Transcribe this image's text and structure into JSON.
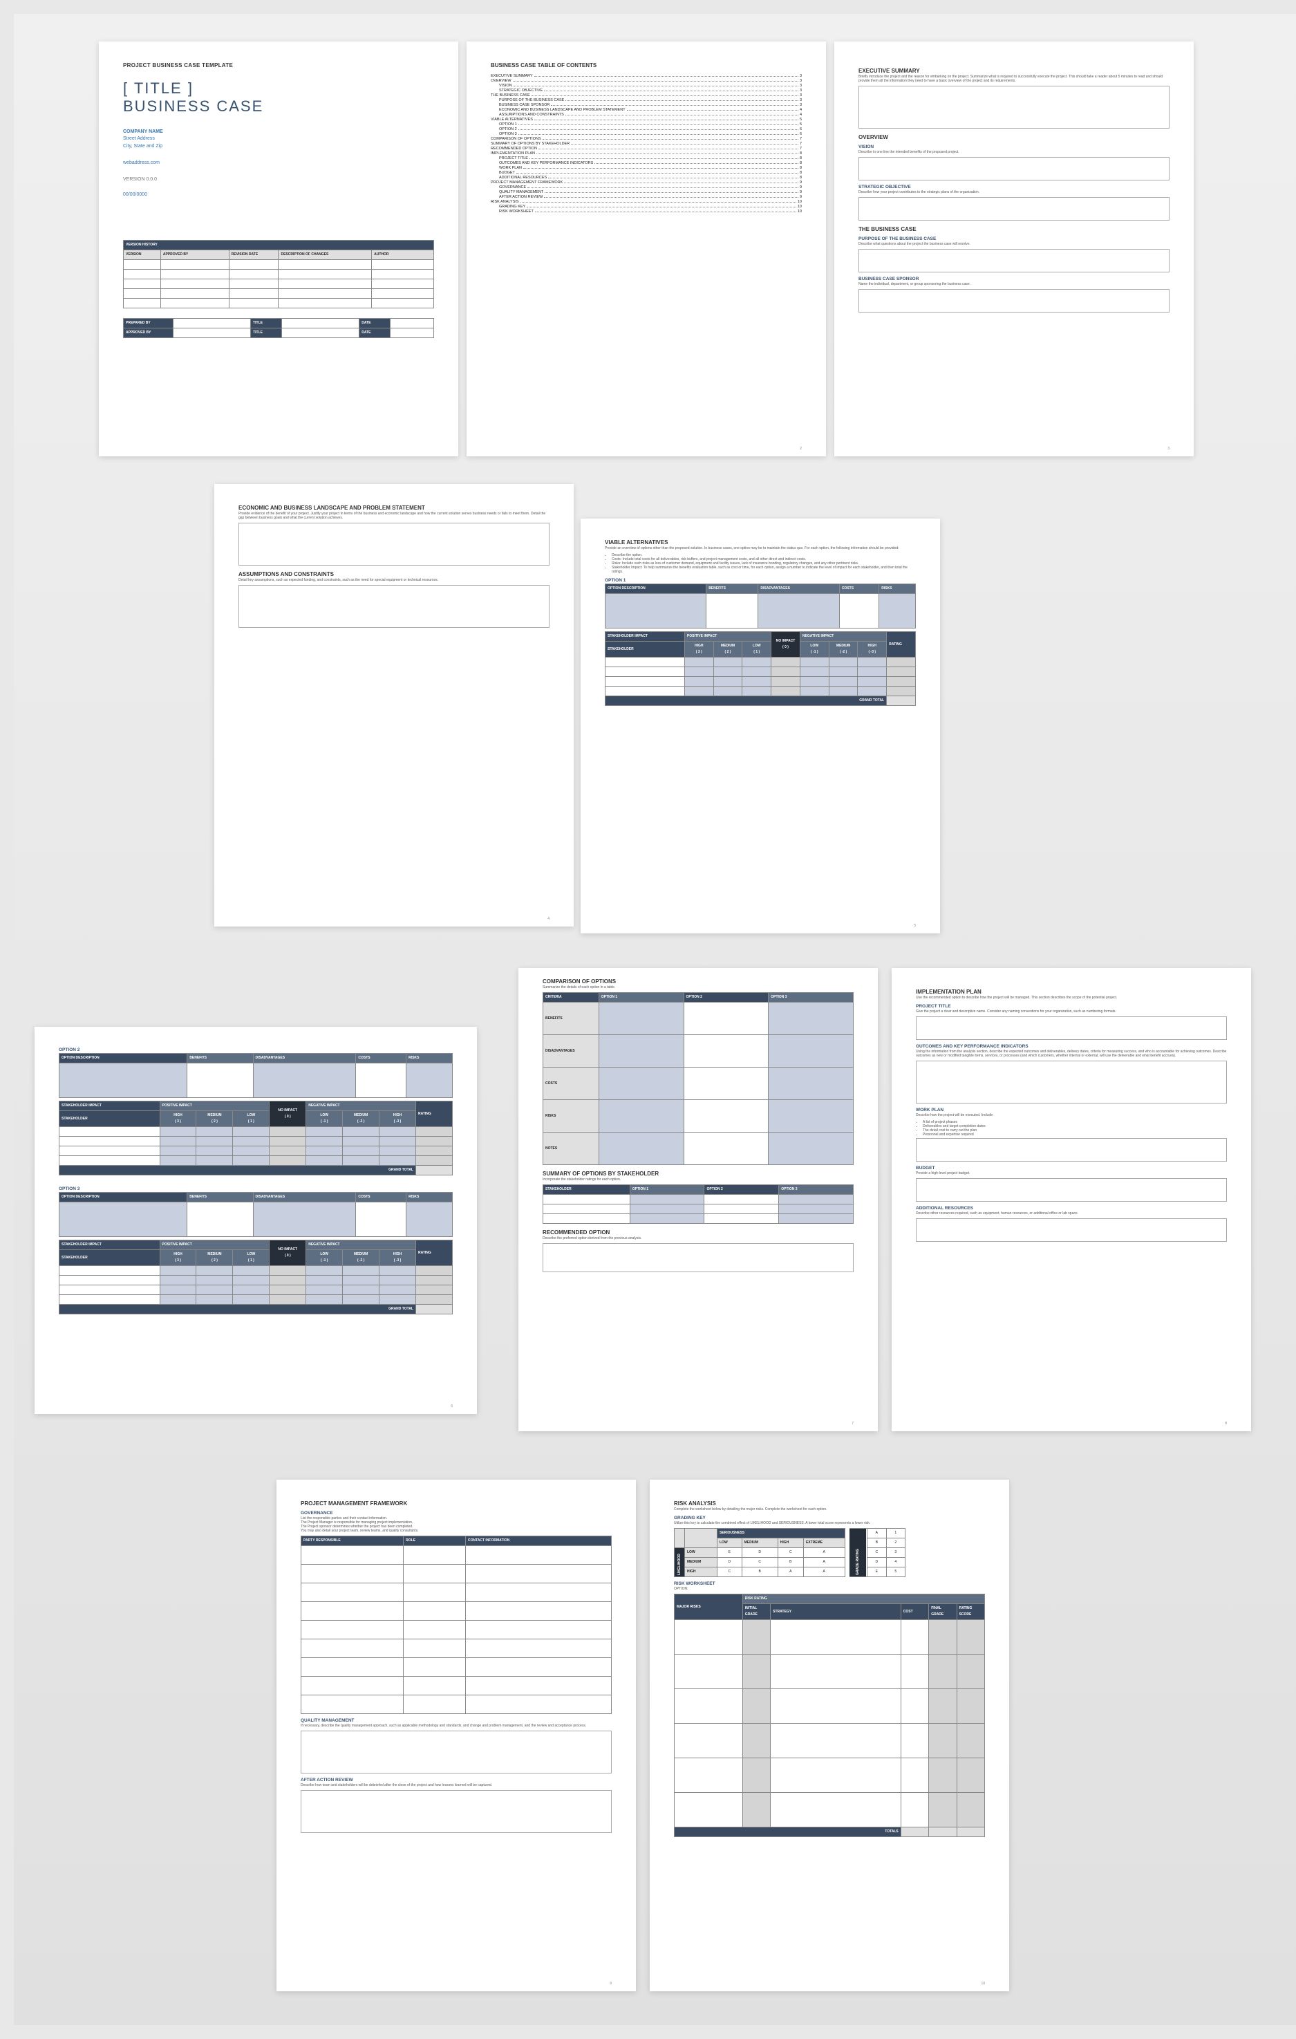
{
  "p1": {
    "label": "PROJECT BUSINESS CASE TEMPLATE",
    "title": "[ TITLE ]\nBUSINESS CASE",
    "company": "COMPANY NAME",
    "addr1": "Street Address",
    "addr2": "City, State and Zip",
    "web": "webaddress.com",
    "ver": "VERSION 0.0.0",
    "date": "00/00/0000",
    "vh": "VERSION HISTORY",
    "cols": [
      "VERSION",
      "APPROVED BY",
      "REVISION DATE",
      "DESCRIPTION OF CHANGES",
      "AUTHOR"
    ],
    "sig": {
      "pb": "PREPARED BY",
      "ab": "APPROVED BY",
      "t": "TITLE",
      "d": "DATE"
    }
  },
  "p2": {
    "h": "BUSINESS CASE TABLE OF CONTENTS",
    "items": [
      [
        "EXECUTIVE SUMMARY",
        "3",
        0
      ],
      [
        "OVERVIEW",
        "3",
        0
      ],
      [
        "VISION",
        "3",
        1
      ],
      [
        "STRATEGIC OBJECTIVE",
        "3",
        1
      ],
      [
        "THE BUSINESS CASE",
        "3",
        0
      ],
      [
        "PURPOSE OF THE BUSINESS CASE",
        "3",
        1
      ],
      [
        "BUSINESS CASE SPONSOR",
        "3",
        1
      ],
      [
        "ECONOMIC AND BUSINESS LANDSCAPE AND PROBLEM STATEMENT",
        "4",
        1
      ],
      [
        "ASSUMPTIONS AND CONSTRAINTS",
        "4",
        1
      ],
      [
        "VIABLE ALTERNATIVES",
        "5",
        0
      ],
      [
        "OPTION 1",
        "5",
        1
      ],
      [
        "OPTION 2",
        "6",
        1
      ],
      [
        "OPTION 3",
        "6",
        1
      ],
      [
        "COMPARISON OF OPTIONS",
        "7",
        0
      ],
      [
        "SUMMARY OF OPTIONS BY STAKEHOLDER",
        "7",
        0
      ],
      [
        "RECOMMENDED OPTION",
        "7",
        0
      ],
      [
        "IMPLEMENTATION PLAN",
        "8",
        0
      ],
      [
        "PROJECT TITLE",
        "8",
        1
      ],
      [
        "OUTCOMES AND KEY PERFORMANCE INDICATORS",
        "8",
        1
      ],
      [
        "WORK PLAN",
        "8",
        1
      ],
      [
        "BUDGET",
        "8",
        1
      ],
      [
        "ADDITIONAL RESOURCES",
        "8",
        1
      ],
      [
        "PROJECT MANAGEMENT FRAMEWORK",
        "9",
        0
      ],
      [
        "GOVERNANCE",
        "9",
        1
      ],
      [
        "QUALITY MANAGEMENT",
        "9",
        1
      ],
      [
        "AFTER ACTION REVIEW",
        "9",
        1
      ],
      [
        "RISK ANALYSIS",
        "10",
        0
      ],
      [
        "GRADING KEY",
        "10",
        1
      ],
      [
        "RISK WORKSHEET",
        "10",
        1
      ]
    ],
    "pg": "2"
  },
  "p3": {
    "es": "EXECUTIVE SUMMARY",
    "esd": "Briefly introduce the project and the reason for embarking on the project. Summarize what is required to successfully execute the project. This should take a reader about 5 minutes to read and should provide them all the information they need to have a basic overview of the project and its requirements.",
    "ov": "OVERVIEW",
    "vis": "VISION",
    "visd": "Describe in one line the intended benefits of the proposed project.",
    "so": "STRATEGIC OBJECTIVE",
    "sod": "Describe how your project contributes to the strategic plans of the organization.",
    "bc": "THE BUSINESS CASE",
    "pbc": "PURPOSE OF THE BUSINESS CASE",
    "pbcd": "Describe what questions about the project the business case will resolve.",
    "bcs": "BUSINESS CASE SPONSOR",
    "bcsd": "Name the individual, department, or group sponsoring the business case.",
    "pg": "3"
  },
  "p4": {
    "ebl": "ECONOMIC AND BUSINESS LANDSCAPE AND PROBLEM STATEMENT",
    "ebld": "Provide evidence of the benefit of your project. Justify your project in terms of the business and economic landscape and how the current solution serves business needs or fails to meet them. Detail the gap between business goals and what the current solution achieves.",
    "ac": "ASSUMPTIONS AND CONSTRAINTS",
    "acd": "Detail key assumptions, such as expected funding, and constraints, such as the need for special equipment or technical resources.",
    "pg": "4"
  },
  "p5": {
    "va": "VIABLE ALTERNATIVES",
    "vad": "Provide an overview of options other than the proposed solution. In business cases, one option may be to maintain the status quo. For each option, the following information should be provided:",
    "bul": [
      "Describe the option.",
      "Costs: Include total costs for all deliverables, risk buffers, and project management costs, and all other direct and indirect costs.",
      "Risks: Include such risks as loss of customer demand, equipment and facility issues, lack of insurance bonding, regulatory changes, and any other pertinent risks.",
      "Stakeholder Impact: To help summarize the benefits evaluation table, such as cost or time, for each option, assign a number to indicate the level of impact for each stakeholder, and then total the ratings."
    ],
    "o1": "OPTION 1",
    "cols1": [
      "OPTION DESCRIPTION",
      "BENEFITS",
      "DISADVANTAGES",
      "COSTS",
      "RISKS"
    ],
    "si": "STAKEHOLDER IMPACT",
    "pi": "POSITIVE IMPACT",
    "ni": "NEGATIVE IMPACT",
    "sh": "STAKEHOLDER",
    "imp": [
      "HIGH\n( 3 )",
      "MEDIUM\n( 2 )",
      "LOW\n( 1 )",
      "NO IMPACT\n( 0 )",
      "LOW\n( -1 )",
      "MEDIUM\n( -2 )",
      "HIGH\n( -3 )"
    ],
    "rat": "RATING",
    "gt": "GRAND TOTAL",
    "pg": "5"
  },
  "p6": {
    "o2": "OPTION 2",
    "o3": "OPTION 3",
    "pg": "6"
  },
  "p7": {
    "co": "COMPARISON OF OPTIONS",
    "cod": "Summarize the details of each option in a table.",
    "crit": "CRITERIA",
    "opts": [
      "OPTION 1",
      "OPTION 2",
      "OPTION 3"
    ],
    "rows": [
      "BENEFITS",
      "DISADVANTAGES",
      "COSTS",
      "RISKS",
      "NOTES"
    ],
    "sos": "SUMMARY OF OPTIONS BY STAKEHOLDER",
    "sosd": "Incorporate the stakeholder ratings for each option.",
    "sh": "STAKEHOLDER",
    "ro": "RECOMMENDED OPTION",
    "rod": "Describe the preferred option derived from the previous analysis.",
    "pg": "7"
  },
  "p8": {
    "ip": "IMPLEMENTATION PLAN",
    "ipd": "Use the recommended option to describe how the project will be managed. This section describes the scope of the potential project.",
    "pt": "PROJECT TITLE",
    "ptd": "Give the project a clear and descriptive name. Consider any naming conventions for your organization, such as numbering formats.",
    "okpi": "OUTCOMES AND KEY PERFORMANCE INDICATORS",
    "okpid": "Using the information from the analysis section, describe the expected outcomes and deliverables, delivery dates, criteria for measuring success, and who is accountable for achieving outcomes. Describe outcomes as new or modified tangible items, services, or processes (and which customers, whether internal or external, will use the deliverable and what benefit accrues).",
    "wp": "WORK PLAN",
    "wpd": "Describe how the project will be executed. Include:",
    "wpb": [
      "A list of project phases",
      "Deliverables and target completion dates",
      "The detail cost to carry out the plan",
      "Personnel and expertise required"
    ],
    "bud": "BUDGET",
    "budd": "Provide a high-level project budget.",
    "ar": "ADDITIONAL RESOURCES",
    "ard": "Describe other resources required, such as equipment, human resources, or additional office or lab space.",
    "pg": "8"
  },
  "p9": {
    "pmf": "PROJECT MANAGEMENT FRAMEWORK",
    "gov": "GOVERNANCE",
    "govd": "List the responsible parties and their contact information.\nThe Project Manager is responsible for managing project implementation.\nThe Project sponsor determines whether the project has been completed.\nYou may also detail your project team, review teams, and quality consultants.",
    "cols": [
      "PARTY RESPONSIBLE",
      "ROLE",
      "CONTACT INFORMATION"
    ],
    "qm": "QUALITY MANAGEMENT",
    "qmd": "If necessary, describe the quality management approach, such as applicable methodology and standards, and change and problem management, and the review and acceptance process.",
    "aar": "AFTER ACTION REVIEW",
    "aard": "Describe how team and stakeholders will be debriefed after the close of the project and how lessons learned will be captured.",
    "pg": "9"
  },
  "p10": {
    "ra": "RISK ANALYSIS",
    "rad": "Complete the worksheet below by detailing the major risks.  Complete the worksheet for each option.",
    "gk": "GRADING KEY",
    "gkd": "Utilize this key to calculate the combined effect of LIKELIHOOD and SERIOUSNESS. A lower total score represents a lower risk.",
    "ser": "SERIOUSNESS",
    "lik": "LIKELIHOOD",
    "scols": [
      "LOW",
      "MEDIUM",
      "HIGH",
      "EXTREME"
    ],
    "gr": "GRADE   RATING",
    "lrows": [
      "LOW",
      "MEDIUM",
      "HIGH"
    ],
    "grid": [
      [
        "E",
        "D",
        "C",
        "A"
      ],
      [
        "D",
        "C",
        "B",
        "A"
      ],
      [
        "C",
        "B",
        "A",
        "A"
      ],
      [
        "A",
        "1"
      ],
      [
        "B",
        "2"
      ],
      [
        "C",
        "3"
      ],
      [
        "D",
        "4"
      ],
      [
        "E",
        "5"
      ]
    ],
    "rw": "RISK WORKSHEET",
    "opt": "OPTION:",
    "rr": "RISK RATING",
    "rcols": [
      "MAJOR RISKS",
      "INITIAL GRADE",
      "STRATEGY",
      "COST",
      "FINAL GRADE",
      "RATING SCORE"
    ],
    "tot": "TOTALS",
    "pg": "10"
  }
}
